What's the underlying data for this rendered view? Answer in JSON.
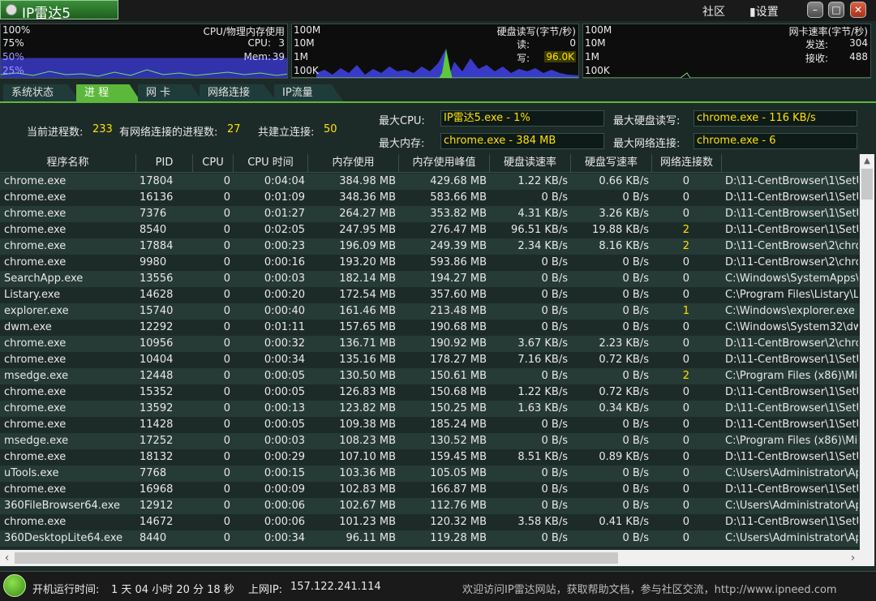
{
  "app": {
    "title": "IP雷达5",
    "community": "社区",
    "settings": "设置"
  },
  "window_controls": {
    "min": "–",
    "max": "□",
    "close": "✕"
  },
  "cpu_panel": {
    "title": "CPU/物理内存使用",
    "levels": [
      "100%",
      "75%",
      "50%",
      "25%"
    ],
    "cpu_label": "CPU:",
    "cpu_value": "3",
    "mem_label": "Mem:",
    "mem_value": "39",
    "mem_level_pct": 39
  },
  "disk_panel": {
    "title": "硬盘读写(字节/秒)",
    "levels": [
      "100M",
      "10M",
      "1M",
      "100K"
    ],
    "read_label": "读:",
    "read_value": "0",
    "write_label": "写:",
    "write_value": "96.0K"
  },
  "net_panel": {
    "title": "网卡速率(字节/秒)",
    "levels": [
      "100M",
      "10M",
      "1M",
      "100K"
    ],
    "send_label": "发送:",
    "send_value": "304",
    "recv_label": "接收:",
    "recv_value": "488"
  },
  "tabs": [
    "系统状态",
    "进 程",
    "网 卡",
    "网络连接",
    "IP流量"
  ],
  "active_tab": 1,
  "summary": {
    "proc_count_label": "当前进程数:",
    "proc_count": "233",
    "net_proc_label": "有网络连接的进程数:",
    "net_proc": "27",
    "conn_label": "共建立连接:",
    "conn": "50",
    "max_cpu_label": "最大CPU:",
    "max_cpu": "IP雷达5.exe - 1%",
    "max_mem_label": "最大内存:",
    "max_mem": "chrome.exe - 384 MB",
    "max_disk_label": "最大硬盘读写:",
    "max_disk": "chrome.exe - 116 KB/s",
    "max_net_label": "最大网络连接:",
    "max_net": "chrome.exe - 6"
  },
  "table": {
    "headers": [
      "程序名称",
      "PID",
      "CPU",
      "CPU 时间",
      "内存使用",
      "内存使用峰值",
      "硬盘读速率",
      "硬盘写速率",
      "网络连接数",
      ""
    ],
    "rows": [
      [
        "chrome.exe",
        "17804",
        "0",
        "0:04:04",
        "384.98 MB",
        "429.68 MB",
        "1.22 KB/s",
        "0.66 KB/s",
        "0",
        "D:\\11-CentBrowser\\1\\SetU"
      ],
      [
        "chrome.exe",
        "16136",
        "0",
        "0:01:09",
        "348.36 MB",
        "583.66 MB",
        "0 B/s",
        "0 B/s",
        "0",
        "D:\\11-CentBrowser\\1\\SetU"
      ],
      [
        "chrome.exe",
        "7376",
        "0",
        "0:01:27",
        "264.27 MB",
        "353.82 MB",
        "4.31 KB/s",
        "3.26 KB/s",
        "0",
        "D:\\11-CentBrowser\\1\\SetU"
      ],
      [
        "chrome.exe",
        "8540",
        "0",
        "0:02:05",
        "247.95 MB",
        "276.47 MB",
        "96.51 KB/s",
        "19.88 KB/s",
        "2",
        "D:\\11-CentBrowser\\1\\SetU"
      ],
      [
        "chrome.exe",
        "17884",
        "0",
        "0:00:23",
        "196.09 MB",
        "249.39 MB",
        "2.34 KB/s",
        "8.16 KB/s",
        "2",
        "D:\\11-CentBrowser\\2\\chro"
      ],
      [
        "chrome.exe",
        "9980",
        "0",
        "0:00:16",
        "193.20 MB",
        "593.86 MB",
        "0 B/s",
        "0 B/s",
        "0",
        "D:\\11-CentBrowser\\2\\chro"
      ],
      [
        "SearchApp.exe",
        "13556",
        "0",
        "0:00:03",
        "182.14 MB",
        "194.27 MB",
        "0 B/s",
        "0 B/s",
        "0",
        "C:\\Windows\\SystemApps\\M"
      ],
      [
        "Listary.exe",
        "14628",
        "0",
        "0:00:20",
        "172.54 MB",
        "357.60 MB",
        "0 B/s",
        "0 B/s",
        "0",
        "C:\\Program Files\\Listary\\Lis"
      ],
      [
        "explorer.exe",
        "15740",
        "0",
        "0:00:40",
        "161.46 MB",
        "213.48 MB",
        "0 B/s",
        "0 B/s",
        "1",
        "C:\\Windows\\explorer.exe"
      ],
      [
        "dwm.exe",
        "12292",
        "0",
        "0:01:11",
        "157.65 MB",
        "190.68 MB",
        "0 B/s",
        "0 B/s",
        "0",
        "C:\\Windows\\System32\\dwm"
      ],
      [
        "chrome.exe",
        "10956",
        "0",
        "0:00:32",
        "136.71 MB",
        "190.92 MB",
        "3.67 KB/s",
        "2.23 KB/s",
        "0",
        "D:\\11-CentBrowser\\2\\chro"
      ],
      [
        "chrome.exe",
        "10404",
        "0",
        "0:00:34",
        "135.16 MB",
        "178.27 MB",
        "7.16 KB/s",
        "0.72 KB/s",
        "0",
        "D:\\11-CentBrowser\\1\\SetU"
      ],
      [
        "msedge.exe",
        "12448",
        "0",
        "0:00:05",
        "130.50 MB",
        "150.61 MB",
        "0 B/s",
        "0 B/s",
        "2",
        "C:\\Program Files (x86)\\Micr"
      ],
      [
        "chrome.exe",
        "15352",
        "0",
        "0:00:05",
        "126.83 MB",
        "150.68 MB",
        "1.22 KB/s",
        "0.72 KB/s",
        "0",
        "D:\\11-CentBrowser\\1\\SetU"
      ],
      [
        "chrome.exe",
        "13592",
        "0",
        "0:00:13",
        "123.82 MB",
        "150.25 MB",
        "1.63 KB/s",
        "0.34 KB/s",
        "0",
        "D:\\11-CentBrowser\\1\\SetU"
      ],
      [
        "chrome.exe",
        "11428",
        "0",
        "0:00:05",
        "109.38 MB",
        "185.24 MB",
        "0 B/s",
        "0 B/s",
        "0",
        "D:\\11-CentBrowser\\1\\SetU"
      ],
      [
        "msedge.exe",
        "17252",
        "0",
        "0:00:03",
        "108.23 MB",
        "130.52 MB",
        "0 B/s",
        "0 B/s",
        "0",
        "C:\\Program Files (x86)\\Micr"
      ],
      [
        "chrome.exe",
        "18132",
        "0",
        "0:00:29",
        "107.10 MB",
        "159.45 MB",
        "8.51 KB/s",
        "0.89 KB/s",
        "0",
        "D:\\11-CentBrowser\\1\\SetU"
      ],
      [
        "uTools.exe",
        "7768",
        "0",
        "0:00:15",
        "103.36 MB",
        "105.05 MB",
        "0 B/s",
        "0 B/s",
        "0",
        "C:\\Users\\Administrator\\App"
      ],
      [
        "chrome.exe",
        "16968",
        "0",
        "0:00:09",
        "102.83 MB",
        "166.87 MB",
        "0 B/s",
        "0 B/s",
        "0",
        "D:\\11-CentBrowser\\1\\SetU"
      ],
      [
        "360FileBrowser64.exe",
        "12912",
        "0",
        "0:00:06",
        "102.67 MB",
        "112.76 MB",
        "0 B/s",
        "0 B/s",
        "0",
        "C:\\Users\\Administrator\\App"
      ],
      [
        "chrome.exe",
        "14672",
        "0",
        "0:00:06",
        "101.23 MB",
        "120.32 MB",
        "3.58 KB/s",
        "0.41 KB/s",
        "0",
        "D:\\11-CentBrowser\\1\\SetU"
      ],
      [
        "360DesktopLite64.exe",
        "8440",
        "0",
        "0:00:34",
        "96.11 MB",
        "119.28 MB",
        "0 B/s",
        "0 B/s",
        "0",
        "C:\\Users\\Administrator\\App"
      ]
    ]
  },
  "status": {
    "uptime_label": "开机运行时间:",
    "uptime": "1 天 04 小时 20 分 18 秒",
    "ip_label": "上网IP:",
    "ip": "157.122.241.114",
    "welcome": "欢迎访问IP雷达网站，获取帮助文档，参与社区交流，http://www.ipneed.com"
  },
  "colors": {
    "accent": "#5cb83a",
    "highlight": "#ffe000",
    "bg": "#1d2b28"
  }
}
